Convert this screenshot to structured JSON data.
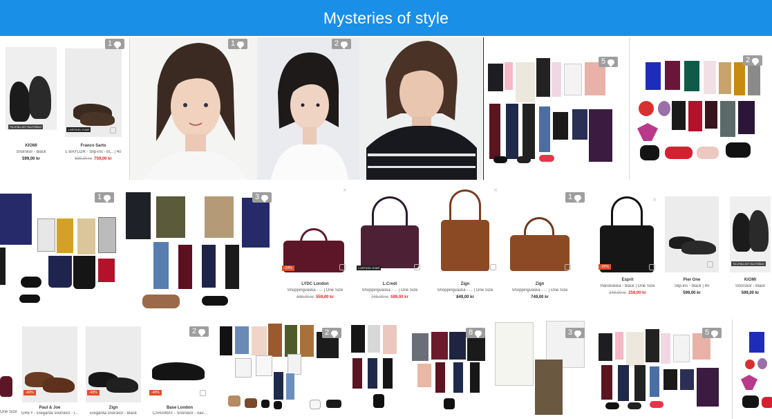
{
  "header": {
    "title": "Mysteries of style",
    "bg_color": "#1a8fe8"
  },
  "row1": {
    "products": [
      {
        "brand": "KIOMI",
        "desc": "Snörskor - black",
        "price": "599,00 kr",
        "tag": "TILLFÄLLIGT SLUTSÅLD"
      },
      {
        "brand": "Franco Sarto",
        "desc": "L-BAYLOR - Slip-ins - bl...",
        "old_price": "699,00 kr",
        "price": "759,00 kr",
        "size": "40",
        "tag": "1 ARTIKEL KVAR"
      }
    ],
    "badges": [
      "1",
      "1",
      "2",
      "5",
      "2"
    ]
  },
  "row2": {
    "badges": [
      "1",
      "3",
      "1"
    ],
    "products": [
      {
        "brand": "LYDC London",
        "desc": "Shoppingväska - ...",
        "size": "One Size",
        "old_price": "699,00 kr",
        "price": "559,00 kr",
        "discount": "-20%"
      },
      {
        "brand": "L.Credi",
        "desc": "Shoppingväska - ...",
        "size": "One Size",
        "old_price": "749,00 kr",
        "price": "599,00 kr",
        "tag": "1 ARTIKEL KVAR"
      },
      {
        "brand": "Zign",
        "desc": "Shoppingväska - ...",
        "size": "One Size",
        "price": "849,00 kr"
      },
      {
        "brand": "Zign",
        "desc": "Shoppingväska - ...",
        "size": "One Size",
        "price": "749,00 kr"
      },
      {
        "brand": "Esprit",
        "desc": "Handväska - black",
        "size": "One Size",
        "old_price": "349,00 kr",
        "price": "259,00 kr",
        "discount": "-25%"
      },
      {
        "brand": "Pier One",
        "desc": "Slip-ins - black",
        "size": "40",
        "price": "599,00 kr"
      },
      {
        "brand": "KIOMI",
        "desc": "Snörskor - black",
        "price": "599,00 kr",
        "tag": "TILLFÄLLIGT SLUTSÅLD"
      }
    ]
  },
  "row3": {
    "badges": [
      "2",
      "2",
      "8",
      "3",
      "5"
    ],
    "products": [
      {
        "brand": "",
        "desc": "One Size",
        "price": ""
      },
      {
        "brand": "Paul & Joe",
        "desc": "GREY - Eleganta snörskor - l...",
        "price": "",
        "discount": "-40%"
      },
      {
        "brand": "Zign",
        "desc": "Eleganta snörskor - black",
        "price": "",
        "discount": "-40%"
      },
      {
        "brand": "Base London",
        "desc": "CARAWAY - Snörskor - nav...",
        "price": "",
        "discount": "-40%"
      }
    ]
  }
}
